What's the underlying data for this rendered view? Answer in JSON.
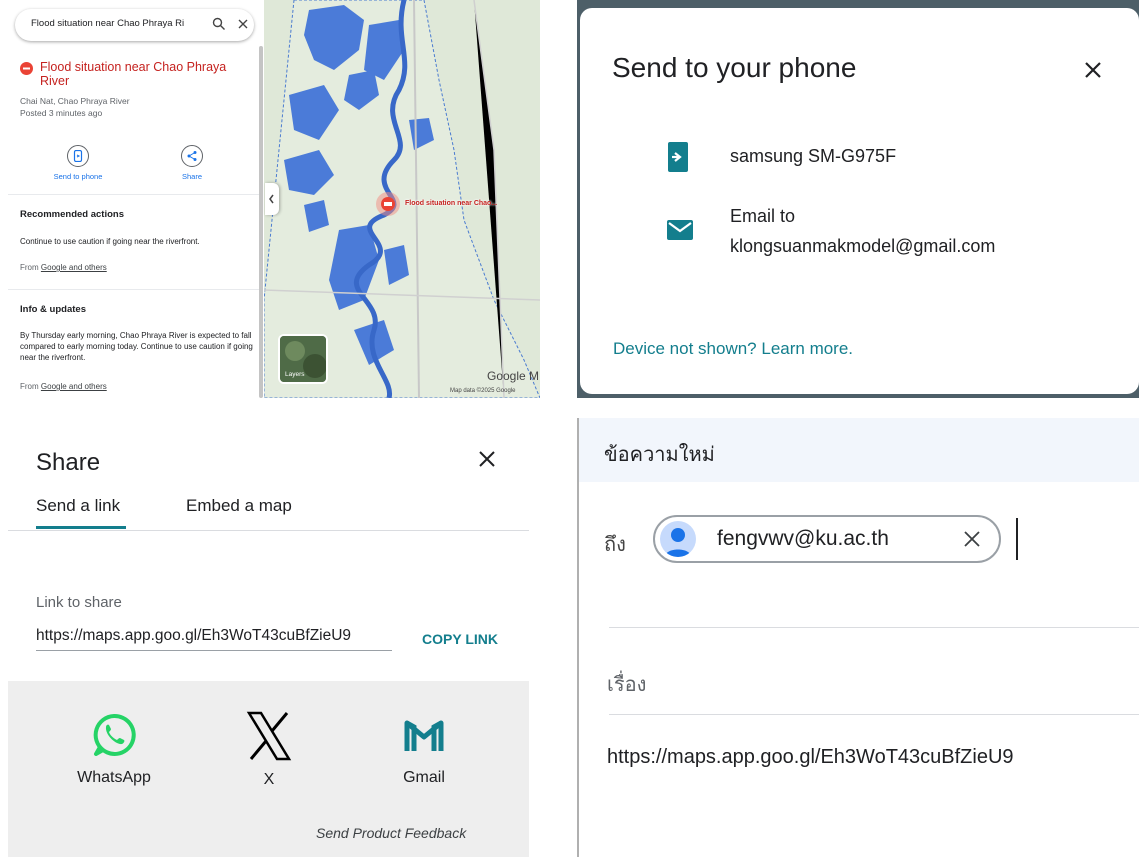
{
  "maps": {
    "search_value": "Flood situation near Chao Phraya Ri",
    "place_title": "Flood situation near Chao Phraya River",
    "location": "Chai Nat, Chao Phraya River",
    "posted": "Posted 3 minutes ago",
    "actions": [
      {
        "label": "Send to phone",
        "icon": "phone-icon"
      },
      {
        "label": "Share",
        "icon": "share-icon"
      }
    ],
    "recommended": {
      "heading": "Recommended actions",
      "text": "Continue to use caution if going near the riverfront.",
      "source_prefix": "From",
      "source_link": "Google and others"
    },
    "info": {
      "heading": "Info & updates",
      "text": "By Thursday early morning, Chao Phraya River is expected to fall compared to early morning today. Continue to use caution if going near the riverfront.",
      "source_prefix": "From",
      "source_link": "Google and others"
    },
    "map_pin_label": "Flood situation near Chao...",
    "layers_label": "Layers",
    "google_logo": "Google M",
    "map_data": "Map data ©2025 Google",
    "flood_color": "#3b6fd8",
    "alert_color": "#ea4335"
  },
  "send_to_phone": {
    "title": "Send to your phone",
    "device": "samsung SM-G975F",
    "email_line1": "Email to",
    "email_line2": "klongsuanmakmodel@gmail.com",
    "learn_more": "Device not shown? Learn more.",
    "accent_color": "#137e8d"
  },
  "share": {
    "title": "Share",
    "tabs": [
      "Send a link",
      "Embed a map"
    ],
    "link_label": "Link to share",
    "link_value": "https://maps.app.goo.gl/Eh3WoT43cuBfZieU9",
    "copy_label": "COPY LINK",
    "targets": [
      {
        "label": "WhatsApp",
        "icon": "whatsapp-icon",
        "color": "#25d366"
      },
      {
        "label": "X",
        "icon": "x-logo-icon",
        "color": "#000000"
      },
      {
        "label": "Gmail",
        "icon": "gmail-icon",
        "color": "#137e8d"
      }
    ],
    "feedback": "Send Product Feedback"
  },
  "compose": {
    "header": "ข้อความใหม่",
    "to_label": "ถึง",
    "recipient": "fengvwv@ku.ac.th",
    "subject_placeholder": "เรื่อง",
    "body": "https://maps.app.goo.gl/Eh3WoT43cuBfZieU9"
  }
}
